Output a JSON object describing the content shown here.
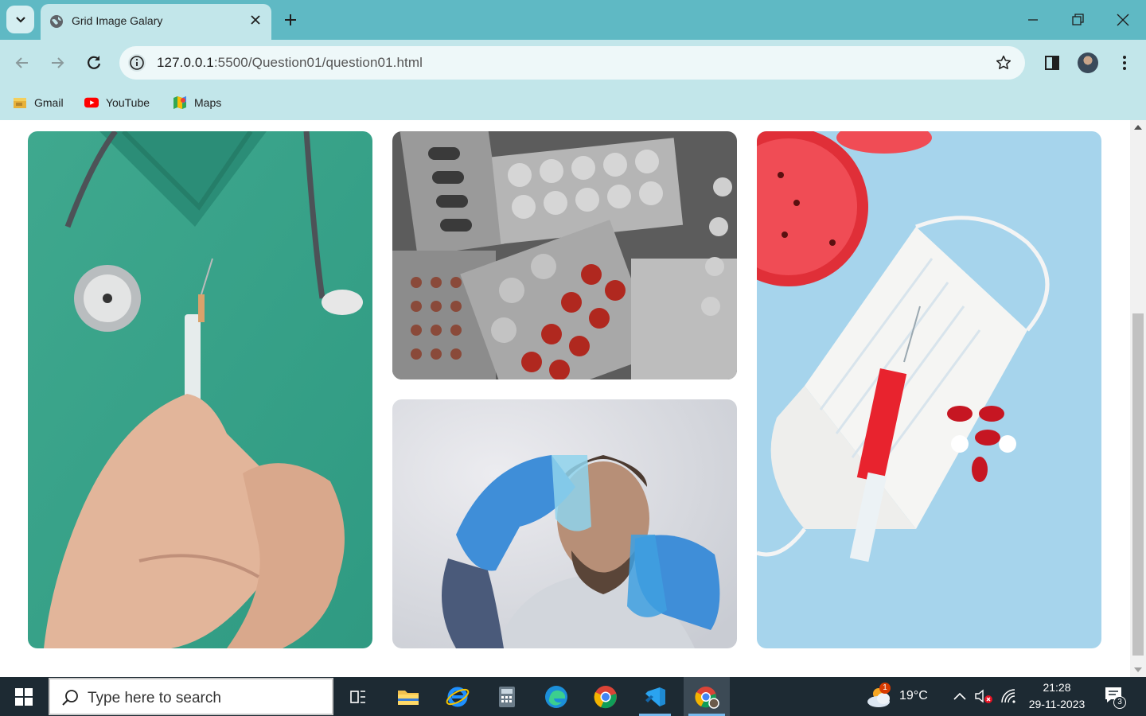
{
  "browser": {
    "tab_title": "Grid Image Galary",
    "url_host": "127.0.0.1",
    "url_rest": ":5500/Question01/question01.html"
  },
  "bookmarks": [
    {
      "label": "Gmail"
    },
    {
      "label": "YouTube"
    },
    {
      "label": "Maps"
    }
  ],
  "gallery": {
    "images": [
      {
        "name": "doctor-syringe",
        "alt": "Doctor in green scrubs holding a syringe"
      },
      {
        "name": "pills-blister",
        "alt": "Blister packs of pills"
      },
      {
        "name": "scientist-flasks",
        "alt": "Scientist holding blue flasks"
      },
      {
        "name": "mask-syringe",
        "alt": "Face mask, syringe and capsules on blue"
      }
    ]
  },
  "taskbar": {
    "search_placeholder": "Type here to search",
    "weather": "19°C",
    "weather_badge": "1",
    "time": "21:28",
    "date": "29-11-2023",
    "notification_count": "3"
  },
  "colors": {
    "tab_strip": "#5fb9c4",
    "toolbar": "#c2e6ea",
    "taskbar": "#1d2a33"
  }
}
